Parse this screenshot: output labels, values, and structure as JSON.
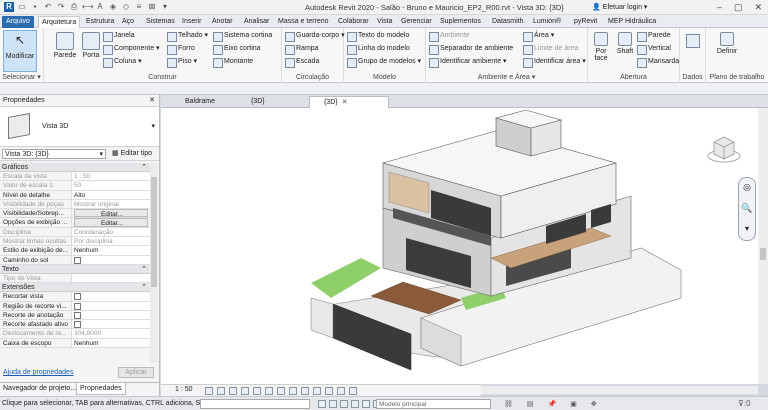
{
  "window": {
    "title": "Autodesk Revit 2020 - Salão - Bruno e Mauricio_EP2_R00.rvt - Vista 3D: {3D}",
    "login": "Efetuar login"
  },
  "menu_tabs": [
    "Arquivo",
    "Arquitetura",
    "Estrutura",
    "Aço",
    "Sistemas",
    "Inserir",
    "Anotar",
    "Analisar",
    "Massa e terreno",
    "Colaborar",
    "Vista",
    "Gerenciar",
    "Suplementos",
    "Datasmith",
    "Lumion®",
    "pyRevit",
    "MEP Hidráulica"
  ],
  "ribbon": {
    "select": {
      "modify": "Modificar",
      "label": "Selecionar ▾"
    },
    "build": {
      "label": "Construir",
      "parede": "Parede",
      "porta": "Porta",
      "janela": "Janela",
      "componente": "Componente ▾",
      "coluna": "Coluna ▾",
      "telhado": "Telhado ▾",
      "forro": "Forro",
      "piso": "Piso ▾",
      "sistema_cortina": "Sistema cortina",
      "eixo_cortina": "Eixo cortina",
      "montante": "Montante"
    },
    "circ": {
      "label": "Circulação",
      "guarda": "Guarda-corpo ▾",
      "rampa": "Rampa",
      "escada": "Escada"
    },
    "model": {
      "label": "Modelo",
      "texto": "Texto do modelo",
      "linha": "Linha do modelo",
      "grupo": "Grupo de modelos ▾"
    },
    "room": {
      "label": "Ambiente e Área ▾",
      "ambiente": "Ambiente",
      "separador": "Separador de ambiente",
      "identificar_ambiente": "Identificar ambiente ▾",
      "area": "Área ▾",
      "limite": "Limite de área",
      "identificar_area": "Identificar área ▾"
    },
    "opening": {
      "label": "Abertura",
      "por_face": "Por face",
      "shaft": "Shaft",
      "parede": "Parede",
      "vertical": "Vertical",
      "mansarda": "Mansarda"
    },
    "datum": {
      "label": "Dados"
    },
    "work": {
      "label": "Plano de trabalho",
      "definir": "Definir"
    }
  },
  "properties": {
    "header": "Propriedades",
    "type_name": "Vista 3D",
    "view_selector": "Vista 3D: {3D}",
    "edit_type": "Editar tipo",
    "sections": [
      {
        "name": "Gráficos",
        "rows": [
          {
            "k": "Escala da vista",
            "v": "1 : 50",
            "dim": true
          },
          {
            "k": "Valor de escala    1:",
            "v": "50",
            "dim": true
          },
          {
            "k": "Nível de detalhe",
            "v": "Alto"
          },
          {
            "k": "Visibilidade de peças",
            "v": "Mostrar original",
            "dim": true
          },
          {
            "k": "Visibilidade/Sobrep...",
            "v": "Editar...",
            "btn": true
          },
          {
            "k": "Opções de exibição ...",
            "v": "Editar...",
            "btn": true
          },
          {
            "k": "Disciplina",
            "v": "Coordenação",
            "dim": true
          },
          {
            "k": "Mostrar linhas ocultas",
            "v": "Por disciplina",
            "dim": true
          },
          {
            "k": "Estilo de exibição de...",
            "v": "Nenhum"
          },
          {
            "k": "Caminho do sol",
            "v": "",
            "cb": true
          }
        ]
      },
      {
        "name": "Texto",
        "rows": [
          {
            "k": "Tipo de Vista",
            "v": "",
            "dim": true
          }
        ]
      },
      {
        "name": "Extensões",
        "rows": [
          {
            "k": "Recortar vista",
            "v": "",
            "cb": true
          },
          {
            "k": "Região de recorte vi...",
            "v": "",
            "cb": true
          },
          {
            "k": "Recorte de anotação",
            "v": "",
            "cb": true
          },
          {
            "k": "Recorte afastado ativo",
            "v": "",
            "cb": true
          },
          {
            "k": "Deslocamento de re...",
            "v": "304,8000",
            "dim": true
          },
          {
            "k": "Caixa de escopo",
            "v": "Nenhum"
          }
        ]
      }
    ],
    "help": "Ajuda de propriedades",
    "apply": "Aplicar",
    "bottom_tabs": [
      "Navegador de projeto...",
      "Propriedades"
    ]
  },
  "view_tabs": [
    "Baldrame",
    "{3D}",
    "{3D}"
  ],
  "view_scale": "1 : 50",
  "status": {
    "message": "Clique para selecionar, TAB para alternativas, CTRL adiciona, S",
    "model": "Modelo principal",
    "filter_count": ":0"
  }
}
